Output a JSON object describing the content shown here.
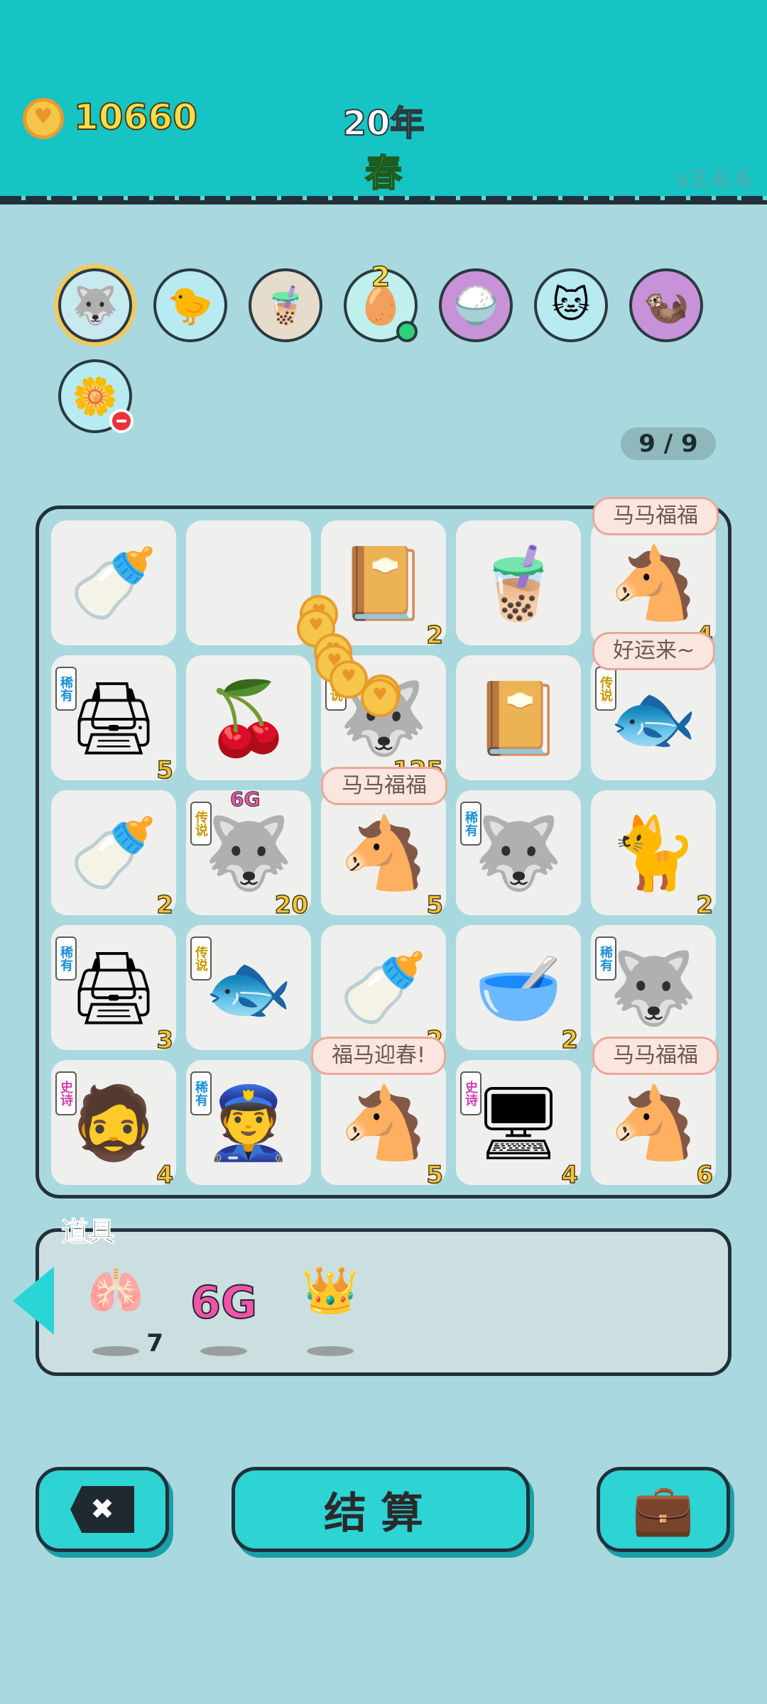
{
  "header": {
    "coins": "10660",
    "year": "20年",
    "season": "春",
    "version": "v3.6.6"
  },
  "buffs": [
    {
      "icon": "husky-coin",
      "symbol": "🐺",
      "bg": "#c8e9ef",
      "selected": true
    },
    {
      "icon": "chick-syringe",
      "symbol": "🐤",
      "bg": "#b8eaf2"
    },
    {
      "icon": "bubble-tea",
      "symbol": "🧋",
      "bg": "#e6dccc"
    },
    {
      "icon": "egg-tray",
      "symbol": "🥚",
      "bg": "#bff0ee",
      "count": "2",
      "dot": true
    },
    {
      "icon": "rice-bowls",
      "symbol": "🍚",
      "bg": "#c892d8"
    },
    {
      "icon": "cat-coin",
      "symbol": "🐱",
      "bg": "#b8eaf2"
    },
    {
      "icon": "meerkats",
      "symbol": "🦦",
      "bg": "#c892d8"
    },
    {
      "icon": "potted-flower",
      "symbol": "🌼",
      "bg": "#b8eaf2",
      "minus": true
    }
  ],
  "slot_counter": "9 / 9",
  "board": [
    [
      {
        "name": "milk-bottle",
        "symbol": "🍼"
      },
      {
        "name": "empty",
        "symbol": ""
      },
      {
        "name": "book",
        "symbol": "📔",
        "count": "2"
      },
      {
        "name": "pink-bowl-tea",
        "symbol": "🧋"
      },
      {
        "name": "horse",
        "symbol": "🐴",
        "count": "4"
      }
    ],
    [
      {
        "name": "printer",
        "symbol": "🖨",
        "rarity": "稀有",
        "rarity_color": "blue",
        "count": "5"
      },
      {
        "name": "cherry",
        "symbol": "🍒"
      },
      {
        "name": "husky",
        "symbol": "🐺",
        "rarity": "传说",
        "rarity_color": "yellow",
        "count": "125"
      },
      {
        "name": "book",
        "symbol": "📔"
      },
      {
        "name": "koi-fish",
        "symbol": "🐟",
        "rarity": "传说",
        "rarity_color": "yellow"
      }
    ],
    [
      {
        "name": "milk-bottle",
        "symbol": "🍼",
        "count": "2"
      },
      {
        "name": "husky-crown",
        "symbol": "🐺",
        "rarity": "传说",
        "rarity_color": "yellow",
        "count": "20",
        "tag": "6G"
      },
      {
        "name": "horse",
        "symbol": "🐴",
        "count": "5"
      },
      {
        "name": "husky-gray",
        "symbol": "🐺",
        "rarity": "稀有",
        "rarity_color": "blue"
      },
      {
        "name": "yellow-cat",
        "symbol": "🐈",
        "count": "2"
      }
    ],
    [
      {
        "name": "printer",
        "symbol": "🖨",
        "rarity": "稀有",
        "rarity_color": "blue",
        "count": "3"
      },
      {
        "name": "koi-fish",
        "symbol": "🐟",
        "rarity": "传说",
        "rarity_color": "yellow"
      },
      {
        "name": "milk-bottle",
        "symbol": "🍼",
        "count": "2"
      },
      {
        "name": "bowl",
        "symbol": "🥣",
        "count": "2"
      },
      {
        "name": "husky-gray",
        "symbol": "🐺",
        "rarity": "稀有",
        "rarity_color": "blue"
      }
    ],
    [
      {
        "name": "green-hair-man",
        "symbol": "🧔",
        "rarity": "史诗",
        "rarity_color": "pink",
        "count": "4"
      },
      {
        "name": "police",
        "symbol": "👮",
        "rarity": "稀有",
        "rarity_color": "blue"
      },
      {
        "name": "horse",
        "symbol": "🐴",
        "count": "5"
      },
      {
        "name": "gpu",
        "symbol": "🖥",
        "rarity": "史诗",
        "rarity_color": "pink",
        "count": "4"
      },
      {
        "name": "horse",
        "symbol": "🐴",
        "count": "6"
      }
    ]
  ],
  "bubbles": [
    {
      "text": "马马福福"
    },
    {
      "text": "好运来~"
    },
    {
      "text": "马马福福"
    },
    {
      "text": "福马迎春!"
    },
    {
      "text": "马马福福"
    }
  ],
  "items": {
    "title": "道具",
    "list": [
      {
        "name": "liver",
        "symbol": "🫁",
        "qty": "7"
      },
      {
        "name": "6g",
        "symbol": "6G",
        "qty": ""
      },
      {
        "name": "crown",
        "symbol": "👑",
        "qty": ""
      }
    ]
  },
  "buttons": {
    "close_icon": "✖",
    "settle_label": "结算",
    "bag_icon": "💼"
  },
  "colors": {
    "header": "#17c4c4",
    "accent": "#2ed3d3",
    "coin": "#f6c64a"
  }
}
